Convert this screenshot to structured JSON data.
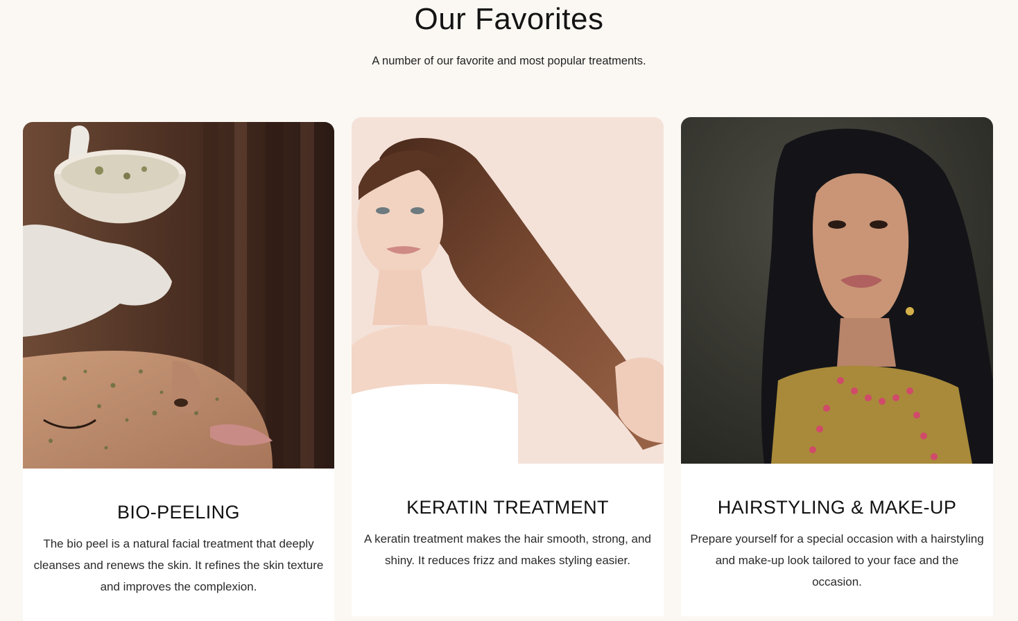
{
  "section": {
    "title": "Our Favorites",
    "subtitle": "A number of our favorite and most popular treatments."
  },
  "cards": [
    {
      "title": "BIO-PEELING",
      "description": "The bio peel is a natural facial treatment that deeply cleanses and renews the skin. It refines the skin texture and improves the complexion."
    },
    {
      "title": "KERATIN TREATMENT",
      "description": "A keratin treatment makes the hair smooth, strong, and shiny. It reduces frizz and makes styling easier."
    },
    {
      "title": "HAIRSTYLING & MAKE-UP",
      "description": "Prepare yourself for a special occasion with a hairstyling and make-up look tailored to your face and the occasion."
    }
  ],
  "colors": {
    "page_background": "#fbf8f3",
    "card_background": "#ffffff",
    "heading_text": "#141414"
  }
}
